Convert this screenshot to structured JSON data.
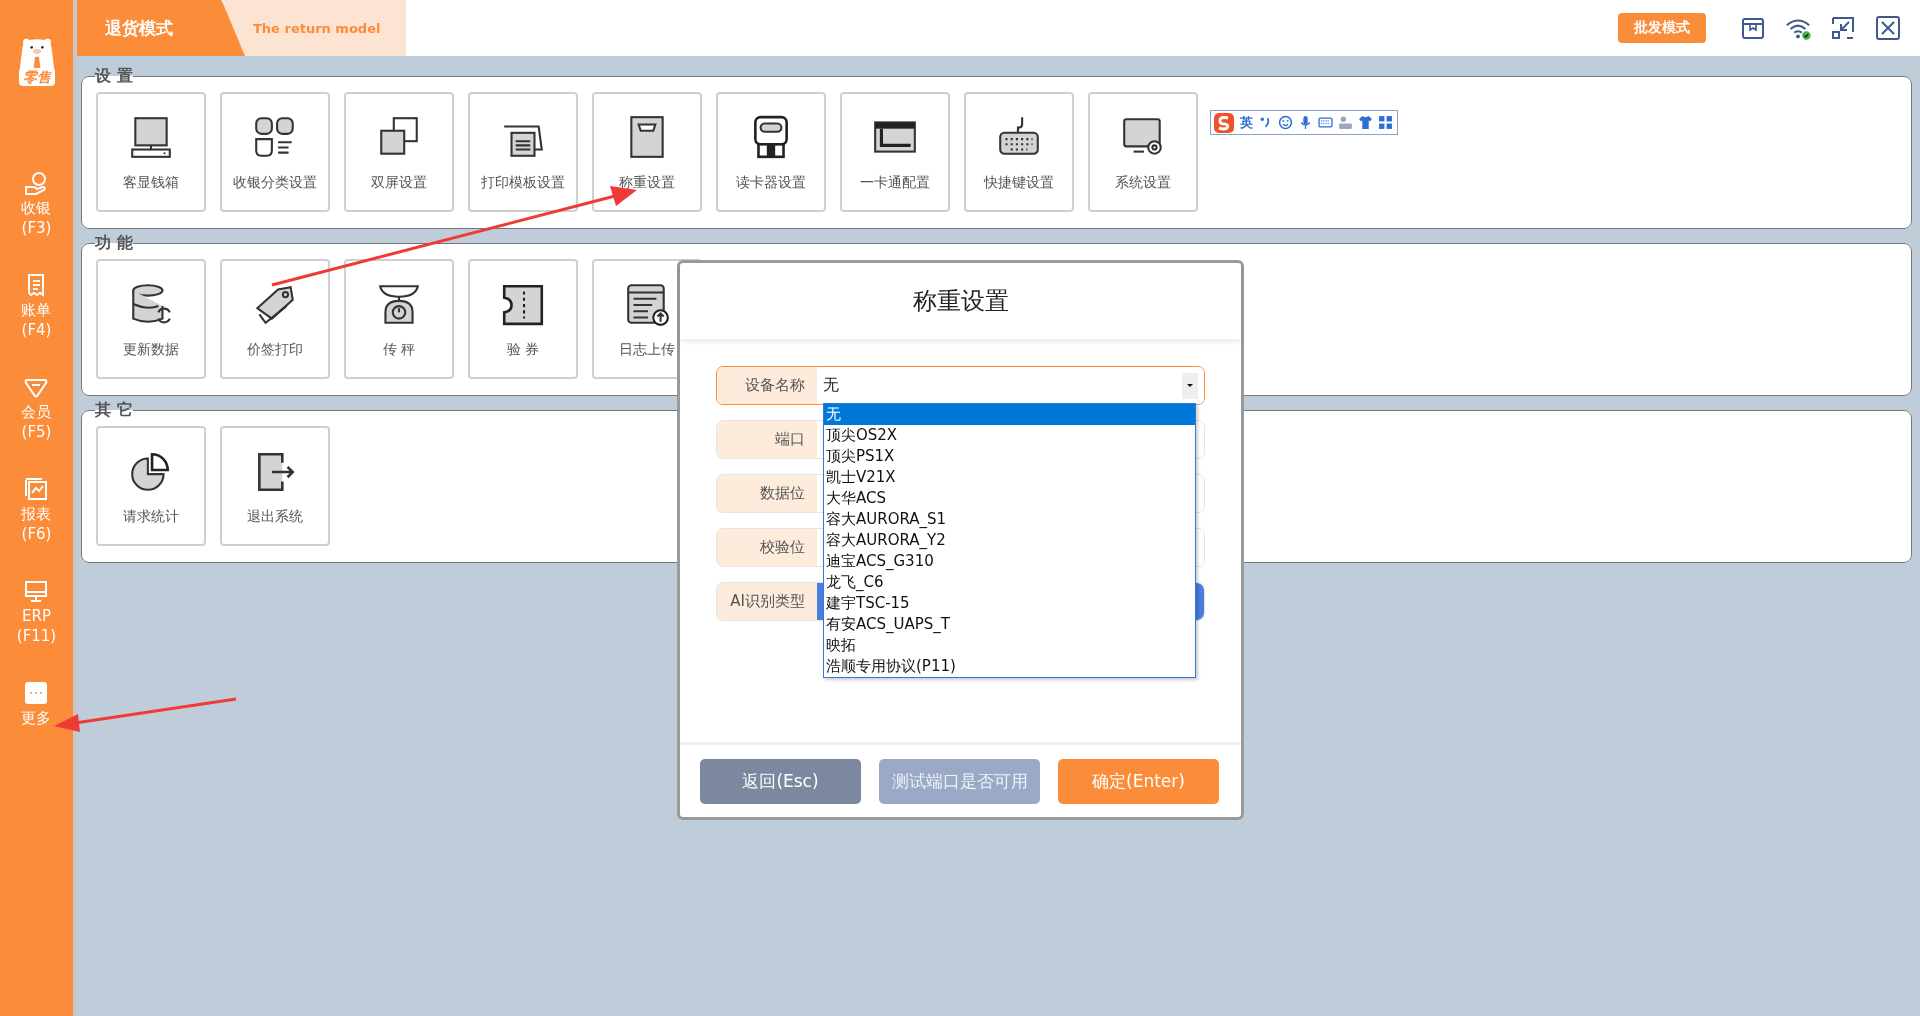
{
  "sidebar": {
    "logo_text": "零售",
    "items": [
      {
        "label": "收银",
        "shortcut": "(F3)"
      },
      {
        "label": "账单",
        "shortcut": "(F4)"
      },
      {
        "label": "会员",
        "shortcut": "(F5)"
      },
      {
        "label": "报表",
        "shortcut": "(F6)"
      },
      {
        "label": "ERP",
        "shortcut": "(F11)"
      },
      {
        "label": "更多"
      }
    ]
  },
  "header": {
    "mode_title": "退货模式",
    "mode_subtitle": "The return model",
    "mode_button": "批发模式"
  },
  "sections": [
    {
      "title": "设 置",
      "tiles": [
        "客显钱箱",
        "收银分类设置",
        "双屏设置",
        "打印模板设置",
        "称重设置",
        "读卡器设置",
        "一卡通配置",
        "快捷键设置",
        "系统设置"
      ]
    },
    {
      "title": "功 能",
      "tiles": [
        "更新数据",
        "价签打印",
        "传 秤",
        "验 券",
        "日志上传"
      ]
    },
    {
      "title": "其 它",
      "tiles": [
        "请求统计",
        "退出系统"
      ]
    }
  ],
  "ime_toolbar": {
    "mode": "英"
  },
  "dialog": {
    "title": "称重设置",
    "rows": [
      {
        "label": "设备名称",
        "kind": "select",
        "value": "无",
        "open": true,
        "options": [
          {
            "text": "无",
            "selected": true
          },
          {
            "text": "顶尖OS2X",
            "selected": false
          },
          {
            "text": "顶尖PS1X",
            "selected": false
          },
          {
            "text": "凯士V21X",
            "selected": false
          },
          {
            "text": "大华ACS",
            "selected": false
          },
          {
            "text": "容大AURORA_S1",
            "selected": false
          },
          {
            "text": "容大AURORA_Y2",
            "selected": false
          },
          {
            "text": "迪宝ACS_G310",
            "selected": false
          },
          {
            "text": "龙飞_C6",
            "selected": false
          },
          {
            "text": "建宇TSC-15",
            "selected": false
          },
          {
            "text": "有安ACS_UAPS_T",
            "selected": false
          },
          {
            "text": "映拓",
            "selected": false
          },
          {
            "text": "浩顺专用协议(P11)",
            "selected": false
          }
        ]
      },
      {
        "label": "端口",
        "kind": "input"
      },
      {
        "label": "数据位",
        "kind": "input"
      },
      {
        "label": "校验位",
        "kind": "input"
      },
      {
        "label": "AI识别类型",
        "kind": "button"
      }
    ],
    "buttons": [
      {
        "label": "返回(Esc)",
        "kind": "secondary",
        "disabled": false
      },
      {
        "label": "测试端口是否可用",
        "kind": "secondary",
        "disabled": true
      },
      {
        "label": "确定(Enter)",
        "kind": "primary",
        "disabled": false
      }
    ]
  }
}
